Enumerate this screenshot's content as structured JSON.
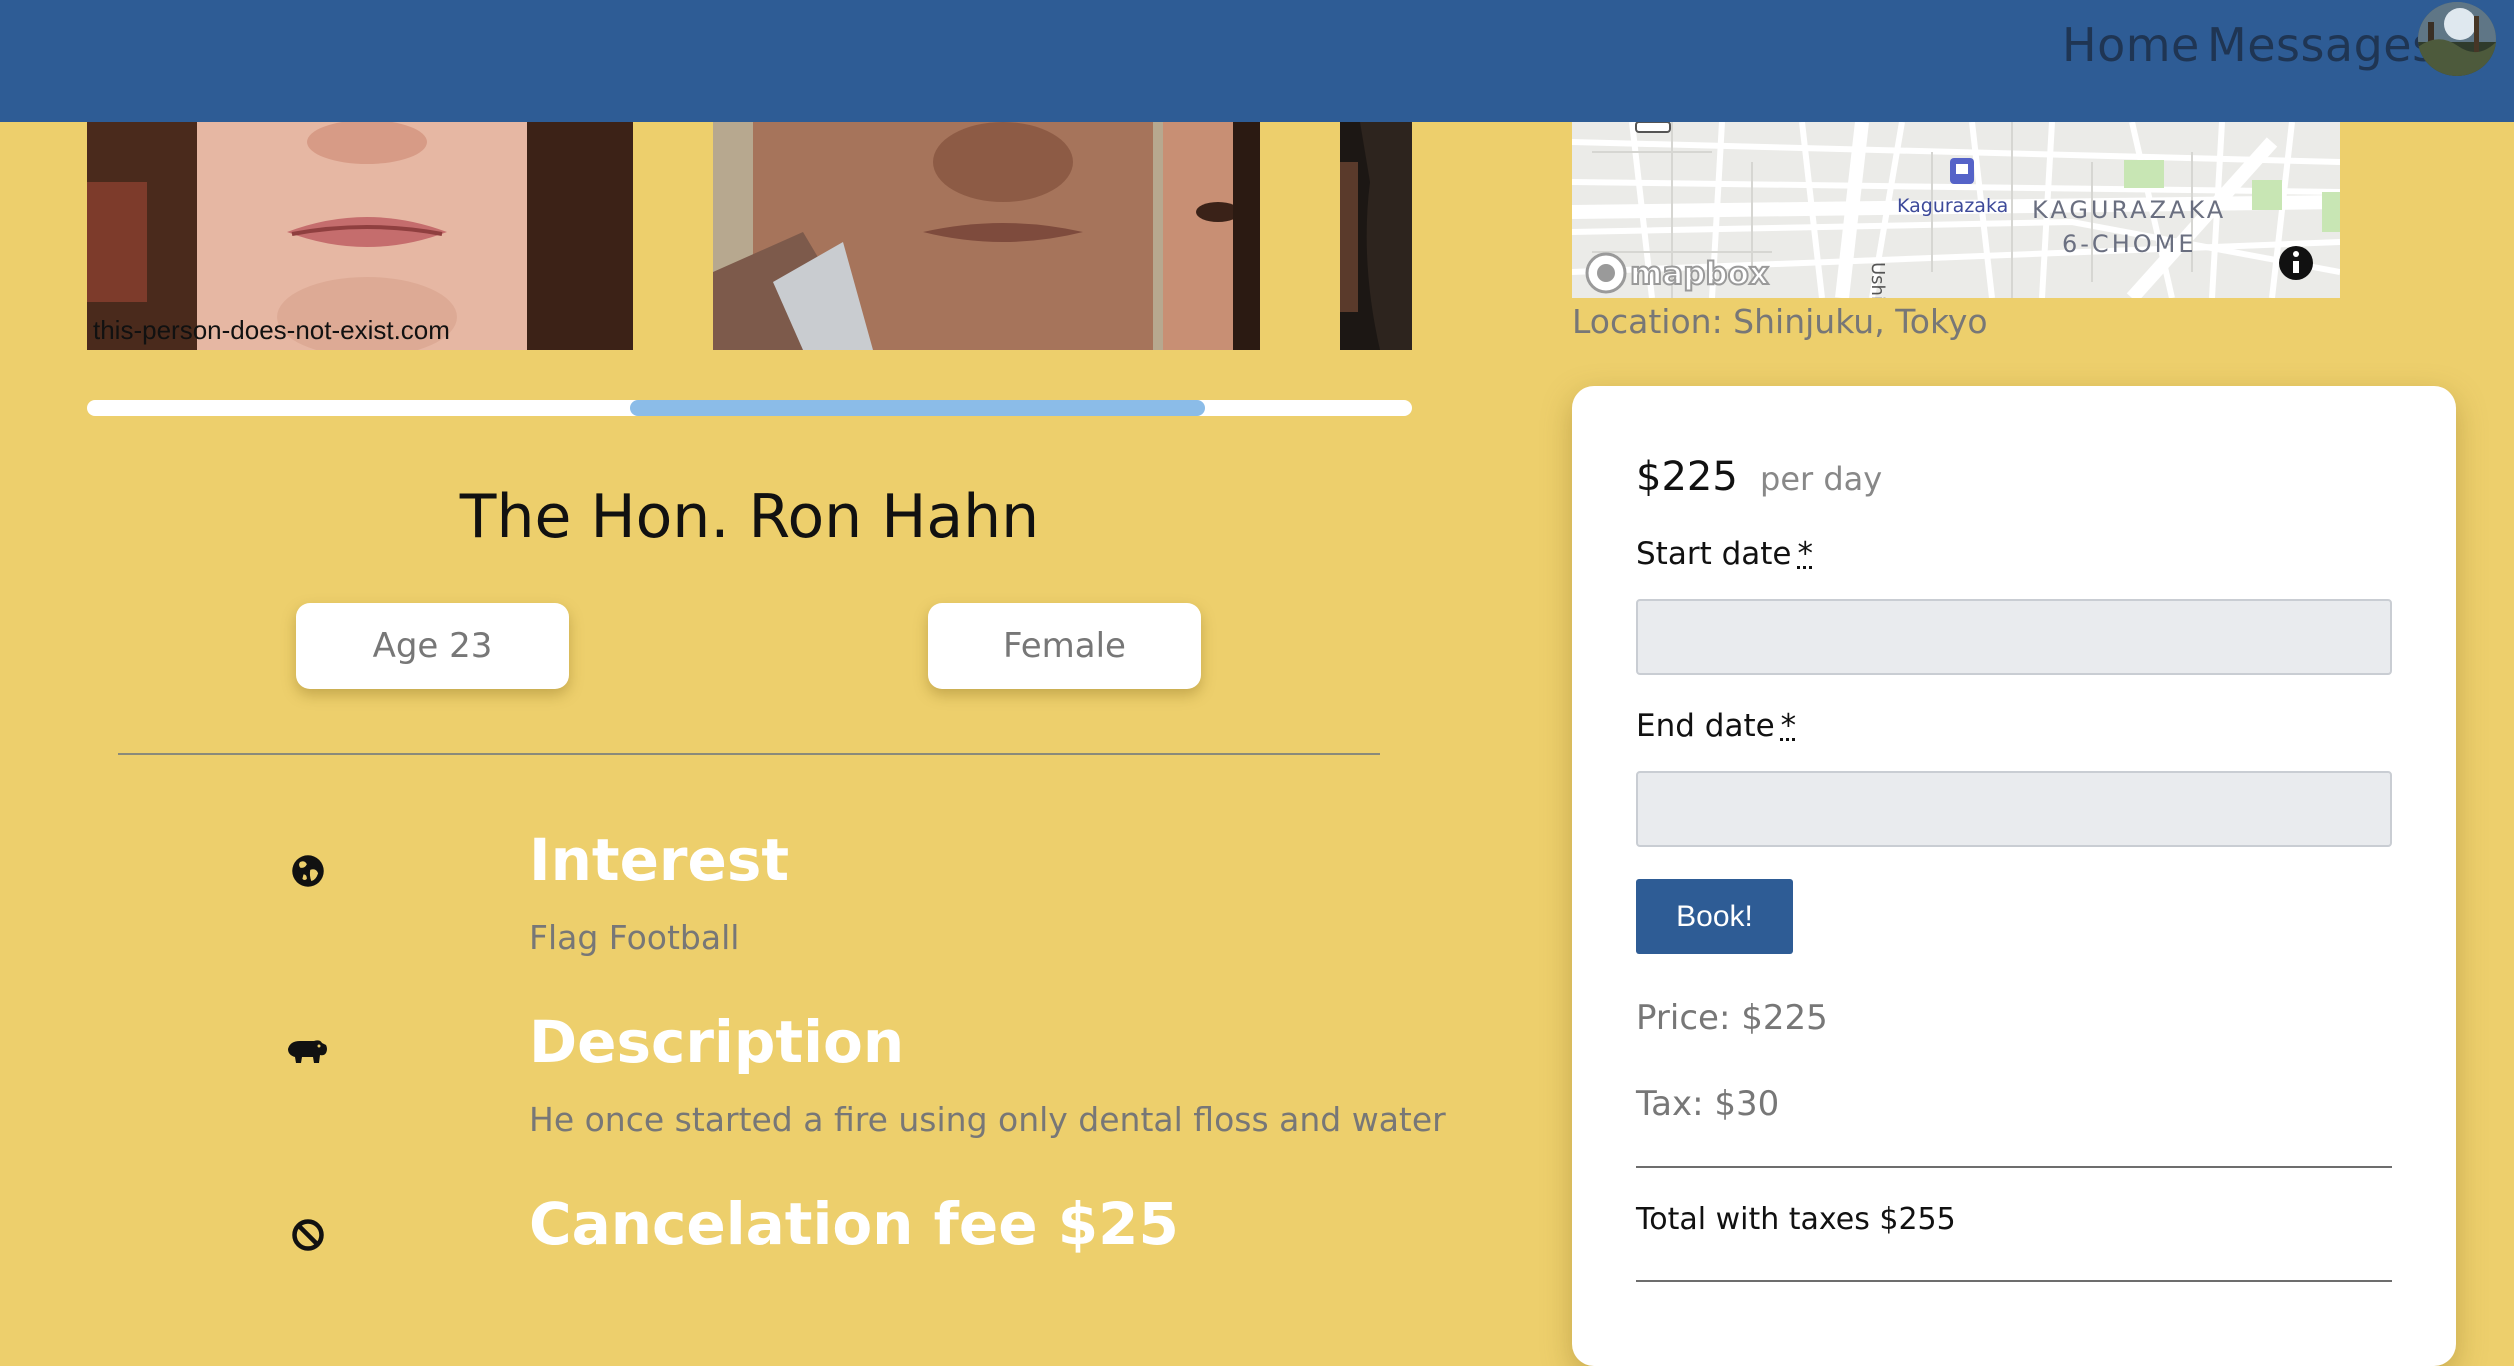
{
  "nav": {
    "home": "Home",
    "messages": "Messages",
    "avatar_icon": "user-avatar"
  },
  "carousel": {
    "watermark": "this-person-does-not-exist.com",
    "progress_fraction": 0.43
  },
  "profile": {
    "name": "The Hon. Ron Hahn",
    "age": "Age 23",
    "gender": "Female"
  },
  "features": [
    {
      "icon": "globe-icon",
      "title": "Interest",
      "text": "Flag Football"
    },
    {
      "icon": "hippo-icon",
      "title": "Description",
      "text": "He once started a fire using only dental floss and water"
    },
    {
      "icon": "ban-icon",
      "title": "Cancelation fee $25",
      "text": ""
    }
  ],
  "map": {
    "station": "Kagurazaka",
    "area_line1": "KAGURAZAKA",
    "area_line2": "6-CHOME",
    "street_fragment": "Ushi",
    "attribution": "mapbox",
    "info_icon": "info-icon"
  },
  "location": {
    "label": "Location: Shinjuku, Tokyo"
  },
  "booking": {
    "price": "$225",
    "per": "per day",
    "start_label": "Start date",
    "end_label": "End date",
    "required_mark": "*",
    "start_value": "",
    "end_value": "",
    "book_button": "Book!",
    "price_line": "Price: $225",
    "tax_line": "Tax: $30",
    "total_line": "Total with taxes $255"
  },
  "colors": {
    "background": "#edcf6c",
    "navbar": "#2e5c95",
    "carousel_thumb": "#8bbce8",
    "button": "#2e5c95"
  }
}
